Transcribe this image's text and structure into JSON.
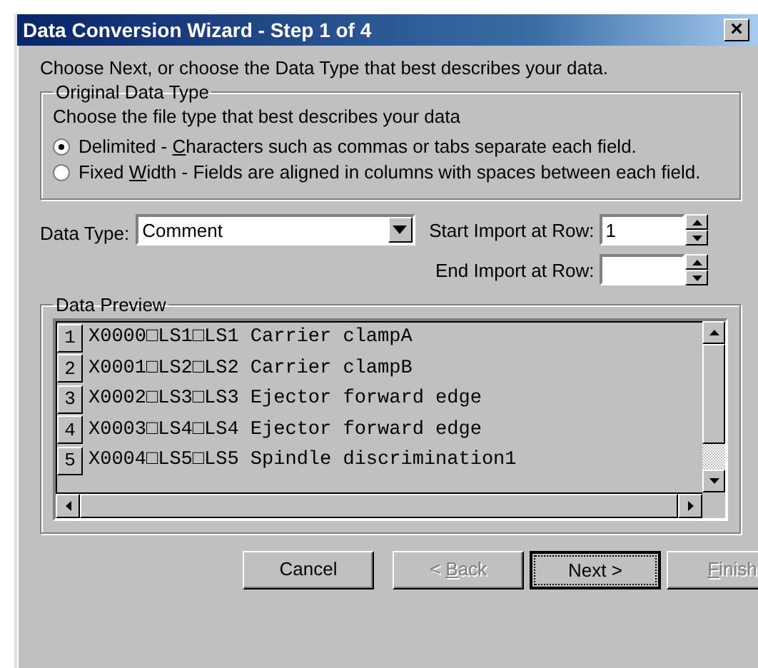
{
  "window": {
    "title": "Data Conversion Wizard - Step 1 of 4",
    "close_glyph": "×"
  },
  "intro": "Choose Next, or choose the Data Type that best describes your data.",
  "original_data_type": {
    "legend": "Original Data Type",
    "hint": "Choose the file type that best describes your data",
    "options": [
      {
        "parts": [
          "Delimited - ",
          "C",
          "haracters such as commas or tabs separate each field."
        ],
        "selected": true
      },
      {
        "parts": [
          "Fixed ",
          "W",
          "idth - Fields are aligned in columns with spaces between each field."
        ],
        "selected": false
      }
    ]
  },
  "data_type": {
    "label": "Data Type:",
    "value": "Comment"
  },
  "start_row": {
    "label": "Start Import at Row:",
    "value": "1"
  },
  "end_row": {
    "label": "End Import at Row:"
  },
  "preview": {
    "legend": "Data Preview",
    "rows": [
      {
        "number": "1",
        "text": "X0000□LS1□LS1 Carrier clampA"
      },
      {
        "number": "2",
        "text": "X0001□LS2□LS2 Carrier clampB"
      },
      {
        "number": "3",
        "text": "X0002□LS3□LS3 Ejector forward edge"
      },
      {
        "number": "4",
        "text": "X0003□LS4□LS4 Ejector forward edge"
      },
      {
        "number": "5",
        "text": "X0004□LS5□LS5 Spindle discrimination1"
      }
    ]
  },
  "buttons": [
    {
      "pre": "Cancel",
      "disabled": false,
      "focused": false
    },
    {
      "pre": "< ",
      "key": "B",
      "post": "ack",
      "disabled": true,
      "focused": false
    },
    {
      "pre": "Next >",
      "disabled": false,
      "focused": true
    },
    {
      "key": "F",
      "post": "inish",
      "disabled": true,
      "focused": false
    }
  ]
}
